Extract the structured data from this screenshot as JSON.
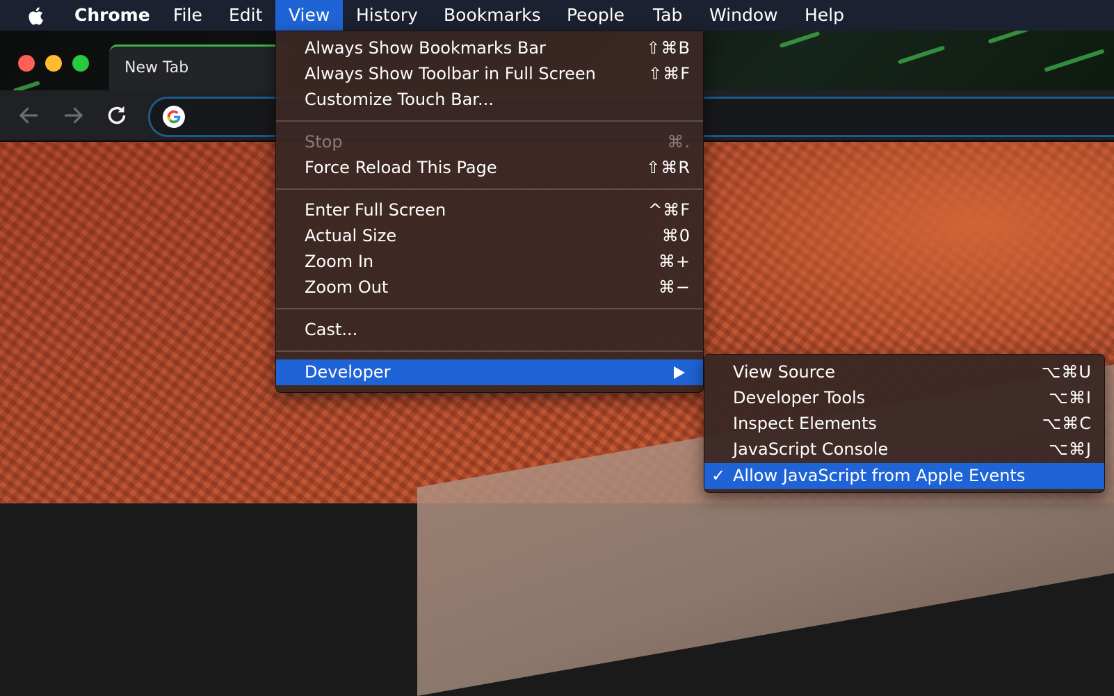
{
  "menubar": {
    "items": [
      "Chrome",
      "File",
      "Edit",
      "View",
      "History",
      "Bookmarks",
      "People",
      "Tab",
      "Window",
      "Help"
    ],
    "active": "View"
  },
  "browser": {
    "tab_title": "New Tab"
  },
  "view_menu": {
    "items": [
      {
        "label": "Always Show Bookmarks Bar",
        "shortcut": "⇧⌘B"
      },
      {
        "label": "Always Show Toolbar in Full Screen",
        "shortcut": "⇧⌘F"
      },
      {
        "label": "Customize Touch Bar...",
        "shortcut": ""
      },
      {
        "label": "Stop",
        "shortcut": "⌘.",
        "disabled": true
      },
      {
        "label": "Force Reload This Page",
        "shortcut": "⇧⌘R"
      },
      {
        "label": "Enter Full Screen",
        "shortcut": "^⌘F"
      },
      {
        "label": "Actual Size",
        "shortcut": "⌘0"
      },
      {
        "label": "Zoom In",
        "shortcut": "⌘+"
      },
      {
        "label": "Zoom Out",
        "shortcut": "⌘−"
      },
      {
        "label": "Cast...",
        "shortcut": ""
      },
      {
        "label": "Developer",
        "shortcut": "",
        "submenu": true,
        "highlighted": true
      }
    ]
  },
  "developer_menu": {
    "items": [
      {
        "label": "View Source",
        "shortcut": "⌥⌘U"
      },
      {
        "label": "Developer Tools",
        "shortcut": "⌥⌘I"
      },
      {
        "label": "Inspect Elements",
        "shortcut": "⌥⌘C"
      },
      {
        "label": "JavaScript Console",
        "shortcut": "⌥⌘J"
      },
      {
        "label": "Allow JavaScript from Apple Events",
        "shortcut": "",
        "checked": true,
        "highlighted": true
      }
    ]
  },
  "colors": {
    "menubar_bg": "#1b2130",
    "highlight": "#1f64d6",
    "menu_bg": "#3a2824",
    "tab_accent": "#3cb648"
  }
}
